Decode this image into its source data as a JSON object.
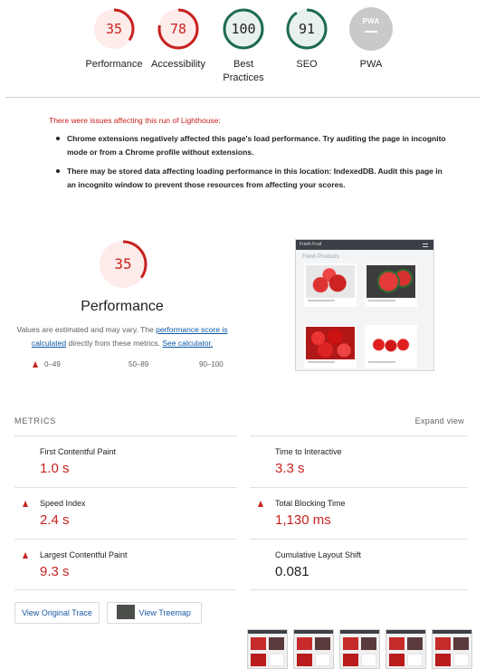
{
  "categories": [
    {
      "label": "Performance",
      "score": "35",
      "color": "#c7221f",
      "fraction": 0.35
    },
    {
      "label": "Accessibility",
      "score": "78",
      "color": "#c7221f",
      "fraction": 0.78
    },
    {
      "label": "Best\nPractices",
      "score": "100",
      "color": "#1e6b52",
      "fraction": 1.0
    },
    {
      "label": "SEO",
      "score": "91",
      "color": "#1e6b52",
      "fraction": 0.91
    },
    {
      "label": "PWA",
      "badge": "PWA",
      "color": "#c9c9c9"
    }
  ],
  "warnings": {
    "title": "There were issues affecting this run of Lighthouse:",
    "items": [
      "Chrome extensions negatively affected this page's load performance. Try auditing the page in incognito mode or from a Chrome profile without extensions.",
      "There may be stored data affecting loading performance in this location: IndexedDB. Audit this page in an incognito window to prevent those resources from affecting your scores."
    ]
  },
  "performance": {
    "score": "35",
    "fraction": 0.35,
    "title": "Performance",
    "desc_prefix": "Values are estimated and may vary. The ",
    "desc_link1": "performance score is calculated",
    "desc_middle": " directly from these metrics. ",
    "desc_link2": "See calculator.",
    "legend": [
      "0–49",
      "50–89",
      "90–100"
    ]
  },
  "screenshot": {
    "app_name": "Fresh Fruit",
    "heading": "Fresh Products"
  },
  "metrics": {
    "label": "METRICS",
    "expand": "Expand view",
    "items": [
      {
        "name": "First Contentful Paint",
        "value": "1.0 s",
        "status": "fail"
      },
      {
        "name": "Time to Interactive",
        "value": "3.3 s",
        "status": "fail"
      },
      {
        "name": "Speed Index",
        "value": "2.4 s",
        "status": "fail"
      },
      {
        "name": "Total Blocking Time",
        "value": "1,130 ms",
        "status": "fail"
      },
      {
        "name": "Largest Contentful Paint",
        "value": "9.3 s",
        "status": "fail"
      },
      {
        "name": "Cumulative Layout Shift",
        "value": "0.081",
        "status": "pass"
      }
    ]
  },
  "buttons": {
    "view_trace": "View Original Trace",
    "view_treemap": "View Treemap"
  },
  "filmstrip_count": 5
}
